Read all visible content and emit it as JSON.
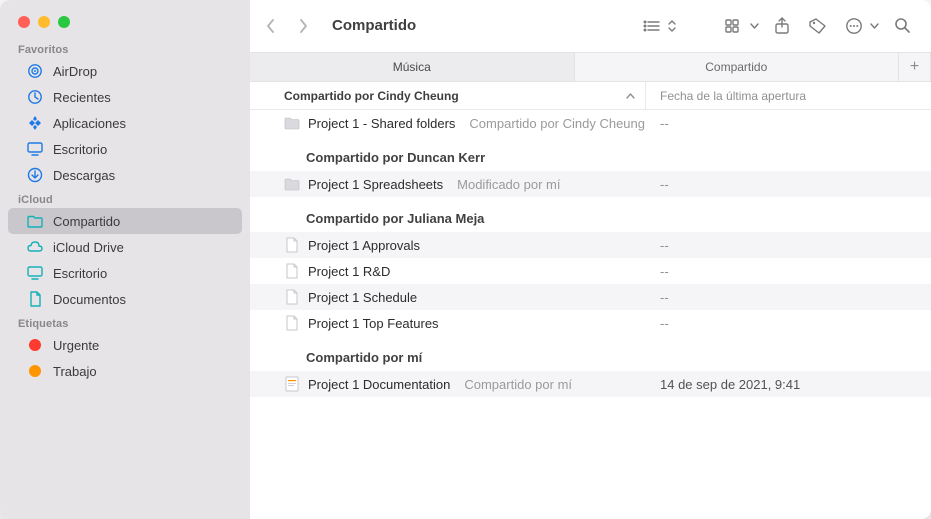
{
  "window": {
    "title": "Compartido"
  },
  "sidebar": {
    "sections": [
      {
        "label": "Favoritos",
        "items": [
          {
            "label": "AirDrop",
            "icon": "airdrop-icon"
          },
          {
            "label": "Recientes",
            "icon": "clock-icon"
          },
          {
            "label": "Aplicaciones",
            "icon": "apps-icon"
          },
          {
            "label": "Escritorio",
            "icon": "desktop-icon"
          },
          {
            "label": "Descargas",
            "icon": "download-icon"
          }
        ]
      },
      {
        "label": "iCloud",
        "items": [
          {
            "label": "Compartido",
            "icon": "shared-folder-icon",
            "selected": true
          },
          {
            "label": "iCloud Drive",
            "icon": "cloud-icon"
          },
          {
            "label": "Escritorio",
            "icon": "desktop-icon"
          },
          {
            "label": "Documentos",
            "icon": "document-icon"
          }
        ]
      },
      {
        "label": "Etiquetas",
        "items": [
          {
            "label": "Urgente",
            "icon": "tag",
            "color": "#ff3b30"
          },
          {
            "label": "Trabajo",
            "icon": "tag",
            "color": "#ff9500"
          }
        ]
      }
    ]
  },
  "tabs": [
    {
      "label": "Música",
      "active": true
    },
    {
      "label": "Compartido",
      "active": false
    }
  ],
  "columns": {
    "name": "Compartido por Cindy Cheung",
    "date": "Fecha de la última apertura"
  },
  "groups": [
    {
      "header": "Compartido por Cindy Cheung",
      "rows": [
        {
          "name": "Project 1 - Shared folders",
          "meta": "Compartido por Cindy Cheung",
          "date": "--",
          "icon": "folder",
          "alt": false
        }
      ]
    },
    {
      "header": "Compartido por Duncan Kerr",
      "rows": [
        {
          "name": "Project 1 Spreadsheets",
          "meta": "Modificado por mí",
          "date": "--",
          "icon": "folder",
          "alt": true
        }
      ]
    },
    {
      "header": "Compartido por Juliana Meja",
      "rows": [
        {
          "name": "Project 1 Approvals",
          "meta": "",
          "date": "--",
          "icon": "doc",
          "alt": true
        },
        {
          "name": "Project 1 R&D",
          "meta": "",
          "date": "--",
          "icon": "doc",
          "alt": false
        },
        {
          "name": "Project 1 Schedule",
          "meta": "",
          "date": "--",
          "icon": "doc",
          "alt": true
        },
        {
          "name": "Project 1 Top Features",
          "meta": "",
          "date": "--",
          "icon": "doc",
          "alt": false
        }
      ]
    },
    {
      "header": "Compartido por mí",
      "rows": [
        {
          "name": "Project 1 Documentation",
          "meta": "Compartido por mí",
          "date": "14 de sep de 2021, 9:41",
          "icon": "pages",
          "alt": true
        }
      ]
    }
  ]
}
